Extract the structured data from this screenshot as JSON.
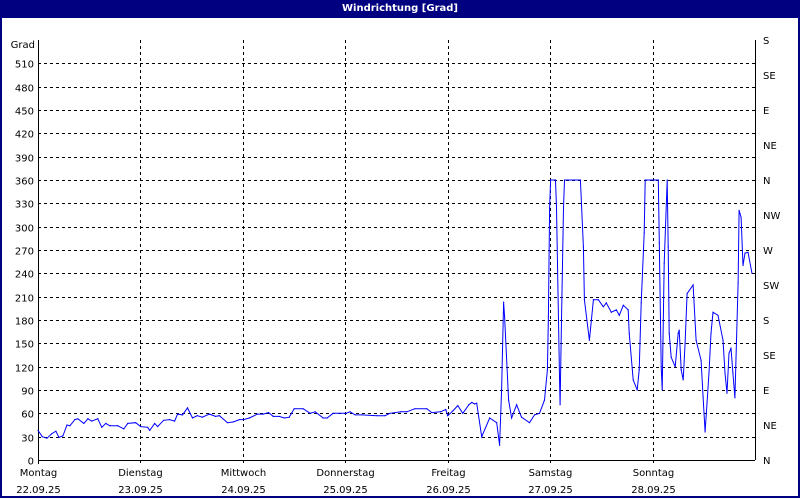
{
  "window": {
    "title": "Windrichtung [Grad]"
  },
  "chart_data": {
    "type": "line",
    "title": "Windrichtung [Grad]",
    "ylabel": "Grad",
    "ylim": [
      0,
      540
    ],
    "y_ticks": [
      0,
      30,
      60,
      90,
      120,
      150,
      180,
      210,
      240,
      270,
      300,
      330,
      360,
      390,
      420,
      450,
      480,
      510
    ],
    "y2_ticks": [
      "N",
      "NE",
      "E",
      "SE",
      "S",
      "SW",
      "W",
      "NW",
      "N",
      "NE",
      "E",
      "SE",
      "S"
    ],
    "x_ticks": [
      {
        "day": "Montag",
        "date": "22.09.25"
      },
      {
        "day": "Dienstag",
        "date": "23.09.25"
      },
      {
        "day": "Mittwoch",
        "date": "24.09.25"
      },
      {
        "day": "Donnerstag",
        "date": "25.09.25"
      },
      {
        "day": "Freitag",
        "date": "26.09.25"
      },
      {
        "day": "Samstag",
        "date": "27.09.25"
      },
      {
        "day": "Sonntag",
        "date": "28.09.25"
      }
    ],
    "xlim": [
      "2025-09-22 00:00",
      "2025-09-29 00:00"
    ],
    "grid": true,
    "line_color": "#0000ff",
    "series": [
      {
        "points": [
          [
            "2025-09-22 00:00",
            38
          ],
          [
            "2025-09-22 01:00",
            30
          ],
          [
            "2025-09-22 02:06",
            28
          ],
          [
            "2025-09-22 03:16",
            34
          ],
          [
            "2025-09-22 04:12",
            37
          ],
          [
            "2025-09-22 04:54",
            29
          ],
          [
            "2025-09-22 05:50",
            31
          ],
          [
            "2025-09-22 06:47",
            45
          ],
          [
            "2025-09-22 07:29",
            44
          ],
          [
            "2025-09-22 08:39",
            52
          ],
          [
            "2025-09-22 09:21",
            53
          ],
          [
            "2025-09-22 10:45",
            47
          ],
          [
            "2025-09-22 11:41",
            53
          ],
          [
            "2025-09-22 12:37",
            50
          ],
          [
            "2025-09-22 14:01",
            53
          ],
          [
            "2025-09-22 14:57",
            42
          ],
          [
            "2025-09-22 15:53",
            47
          ],
          [
            "2025-09-22 16:49",
            44
          ],
          [
            "2025-09-22 18:42",
            44
          ],
          [
            "2025-09-22 20:06",
            40
          ],
          [
            "2025-09-22 21:02",
            47
          ],
          [
            "2025-09-22 22:54",
            48
          ],
          [
            "2025-09-23 00:04",
            43
          ],
          [
            "2025-09-23 01:42",
            42
          ],
          [
            "2025-09-23 02:10",
            38
          ],
          [
            "2025-09-23 03:20",
            47
          ],
          [
            "2025-09-23 04:02",
            43
          ],
          [
            "2025-09-23 05:26",
            51
          ],
          [
            "2025-09-23 06:50",
            52
          ],
          [
            "2025-09-23 08:00",
            50
          ],
          [
            "2025-09-23 08:42",
            59
          ],
          [
            "2025-09-23 09:52",
            58
          ],
          [
            "2025-09-23 11:02",
            67
          ],
          [
            "2025-09-23 12:12",
            54
          ],
          [
            "2025-09-23 13:20",
            57
          ],
          [
            "2025-09-23 14:30",
            55
          ],
          [
            "2025-09-23 16:10",
            59
          ],
          [
            "2025-09-23 17:35",
            56
          ],
          [
            "2025-09-23 18:30",
            57
          ],
          [
            "2025-09-23 20:24",
            48
          ],
          [
            "2025-09-23 21:48",
            49
          ],
          [
            "2025-09-23 23:12",
            52
          ],
          [
            "2025-09-24 00:08",
            52
          ],
          [
            "2025-09-24 01:32",
            54
          ],
          [
            "2025-09-24 03:24",
            59
          ],
          [
            "2025-09-24 04:48",
            59
          ],
          [
            "2025-09-24 06:00",
            61
          ],
          [
            "2025-09-24 07:08",
            56
          ],
          [
            "2025-09-24 08:32",
            56
          ],
          [
            "2025-09-24 09:42",
            54
          ],
          [
            "2025-09-24 10:52",
            55
          ],
          [
            "2025-09-24 12:02",
            66
          ],
          [
            "2025-09-24 14:08",
            66
          ],
          [
            "2025-09-24 15:46",
            60
          ],
          [
            "2025-09-24 16:57",
            62
          ],
          [
            "2025-09-24 18:49",
            54
          ],
          [
            "2025-09-24 19:45",
            54
          ],
          [
            "2025-09-24 21:09",
            60
          ],
          [
            "2025-09-24 22:47",
            60
          ],
          [
            "2025-09-25 00:11",
            60
          ],
          [
            "2025-09-25 01:07",
            62
          ],
          [
            "2025-09-25 02:18",
            58
          ],
          [
            "2025-09-25 03:56",
            58
          ],
          [
            "2025-09-25 07:26",
            57
          ],
          [
            "2025-09-25 09:18",
            57
          ],
          [
            "2025-09-25 10:28",
            60
          ],
          [
            "2025-09-25 13:02",
            62
          ],
          [
            "2025-09-25 14:26",
            62
          ],
          [
            "2025-09-25 16:18",
            66
          ],
          [
            "2025-09-25 19:06",
            66
          ],
          [
            "2025-09-25 20:16",
            61
          ],
          [
            "2025-09-25 22:22",
            62
          ],
          [
            "2025-09-25 23:32",
            65
          ],
          [
            "2025-09-26 00:00",
            57
          ],
          [
            "2025-09-26 01:12",
            63
          ],
          [
            "2025-09-26 02:22",
            70
          ],
          [
            "2025-09-26 03:32",
            60
          ],
          [
            "2025-09-26 04:56",
            71
          ],
          [
            "2025-09-26 05:38",
            74
          ],
          [
            "2025-09-26 06:20",
            72
          ],
          [
            "2025-09-26 06:48",
            73
          ],
          [
            "2025-09-26 07:58",
            30
          ],
          [
            "2025-09-26 09:50",
            54
          ],
          [
            "2025-09-26 11:28",
            48
          ],
          [
            "2025-09-26 12:10",
            19
          ],
          [
            "2025-09-26 12:38",
            90
          ],
          [
            "2025-09-26 13:06",
            203
          ],
          [
            "2025-09-26 13:20",
            184
          ],
          [
            "2025-09-26 14:16",
            77
          ],
          [
            "2025-09-26 14:58",
            54
          ],
          [
            "2025-09-26 16:08",
            71
          ],
          [
            "2025-09-26 17:18",
            55
          ],
          [
            "2025-09-26 19:10",
            48
          ],
          [
            "2025-09-26 20:20",
            58
          ],
          [
            "2025-09-26 21:30",
            60
          ],
          [
            "2025-09-26 22:40",
            77
          ],
          [
            "2025-09-26 23:22",
            116
          ],
          [
            "2025-09-26 23:36",
            184
          ],
          [
            "2025-09-26 23:52",
            324
          ],
          [
            "2025-09-27 00:06",
            360
          ],
          [
            "2025-09-27 01:16",
            360
          ],
          [
            "2025-09-27 01:30",
            324
          ],
          [
            "2025-09-27 02:12",
            107
          ],
          [
            "2025-09-27 02:20",
            71
          ],
          [
            "2025-09-27 02:40",
            180
          ],
          [
            "2025-09-27 03:08",
            324
          ],
          [
            "2025-09-27 03:22",
            360
          ],
          [
            "2025-09-27 07:06",
            360
          ],
          [
            "2025-09-27 07:48",
            274
          ],
          [
            "2025-09-27 08:02",
            206
          ],
          [
            "2025-09-27 09:12",
            154
          ],
          [
            "2025-09-27 10:08",
            206
          ],
          [
            "2025-09-27 11:18",
            206
          ],
          [
            "2025-09-27 12:28",
            197
          ],
          [
            "2025-09-27 13:10",
            202
          ],
          [
            "2025-09-27 14:20",
            190
          ],
          [
            "2025-09-27 15:30",
            193
          ],
          [
            "2025-09-27 16:12",
            186
          ],
          [
            "2025-09-27 17:08",
            199
          ],
          [
            "2025-09-27 18:18",
            193
          ],
          [
            "2025-09-27 18:32",
            163
          ],
          [
            "2025-09-27 19:28",
            103
          ],
          [
            "2025-09-27 20:24",
            90
          ],
          [
            "2025-09-27 20:52",
            116
          ],
          [
            "2025-09-27 21:20",
            202
          ],
          [
            "2025-09-27 22:02",
            292
          ],
          [
            "2025-09-27 22:16",
            360
          ],
          [
            "2025-09-28 01:20",
            360
          ],
          [
            "2025-09-28 01:34",
            279
          ],
          [
            "2025-09-28 02:02",
            120
          ],
          [
            "2025-09-28 02:16",
            90
          ],
          [
            "2025-09-28 02:44",
            253
          ],
          [
            "2025-09-28 03:26",
            360
          ],
          [
            "2025-09-28 03:40",
            274
          ],
          [
            "2025-09-28 03:54",
            163
          ],
          [
            "2025-09-28 04:22",
            132
          ],
          [
            "2025-09-28 05:18",
            120
          ],
          [
            "2025-09-28 06:00",
            163
          ],
          [
            "2025-09-28 06:14",
            167
          ],
          [
            "2025-09-28 06:42",
            116
          ],
          [
            "2025-09-28 07:10",
            103
          ],
          [
            "2025-09-28 07:38",
            150
          ],
          [
            "2025-09-28 08:06",
            214
          ],
          [
            "2025-09-28 09:30",
            225
          ],
          [
            "2025-09-28 10:12",
            154
          ],
          [
            "2025-09-28 11:22",
            128
          ],
          [
            "2025-09-28 11:50",
            81
          ],
          [
            "2025-09-28 12:18",
            36
          ],
          [
            "2025-09-28 13:14",
            112
          ],
          [
            "2025-09-28 13:42",
            163
          ],
          [
            "2025-09-28 14:10",
            190
          ],
          [
            "2025-09-28 15:20",
            186
          ],
          [
            "2025-09-28 16:30",
            154
          ],
          [
            "2025-09-28 16:58",
            112
          ],
          [
            "2025-09-28 17:26",
            86
          ],
          [
            "2025-09-28 17:54",
            137
          ],
          [
            "2025-09-28 18:22",
            144
          ],
          [
            "2025-09-28 18:50",
            112
          ],
          [
            "2025-09-28 19:18",
            80
          ],
          [
            "2025-09-28 20:02",
            227
          ],
          [
            "2025-09-28 20:16",
            321
          ],
          [
            "2025-09-28 20:44",
            312
          ],
          [
            "2025-09-28 21:12",
            250
          ],
          [
            "2025-09-28 21:40",
            266
          ],
          [
            "2025-09-28 22:22",
            267
          ],
          [
            "2025-09-28 23:18",
            240
          ]
        ]
      }
    ]
  }
}
